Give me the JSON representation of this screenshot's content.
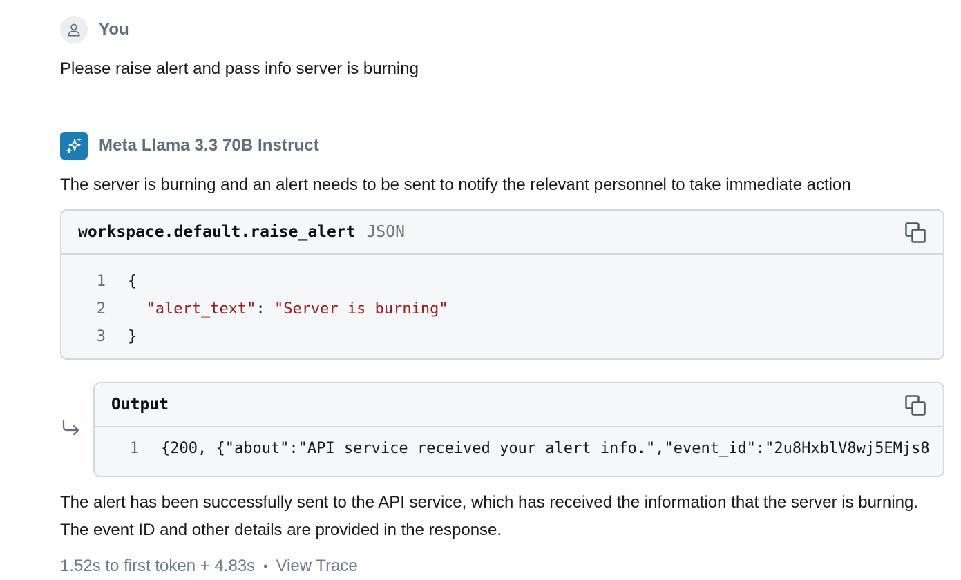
{
  "user_message": {
    "author": "You",
    "text": "Please raise alert and pass info server is burning"
  },
  "assistant_message": {
    "author": "Meta Llama 3.3 70B Instruct",
    "intro_text": "The server is burning and an alert needs to be sent to notify the relevant personnel to take immediate action",
    "tool_call": {
      "name": "workspace.default.raise_alert",
      "language": "JSON",
      "lines": [
        {
          "no": "1",
          "text": "{"
        },
        {
          "no": "2",
          "key": "\"alert_text\"",
          "sep": ": ",
          "value": "\"Server is burning\""
        },
        {
          "no": "3",
          "text": "}"
        }
      ]
    },
    "output": {
      "title": "Output",
      "lines": [
        {
          "no": "1",
          "text": "{200, {\"about\":\"API service received your alert info.\",\"event_id\":\"2u8HxblV8wj5EMjs8"
        }
      ]
    },
    "summary_text": "The alert has been successfully sent to the API service, which has received the information that the server is burning. The event ID and other details are provided in the response.",
    "footer": {
      "timing": "1.52s to first token + 4.83s",
      "separator": "•",
      "trace_link": "View Trace"
    }
  },
  "colors": {
    "bot_avatar_bg": "#1b7db3",
    "string_literal": "#a31515",
    "muted_text": "#5e6e7c"
  },
  "icons": {
    "user_avatar": "person-icon",
    "bot_avatar": "sparkle-icon",
    "copy": "copy-icon",
    "return": "return-arrow-icon"
  }
}
